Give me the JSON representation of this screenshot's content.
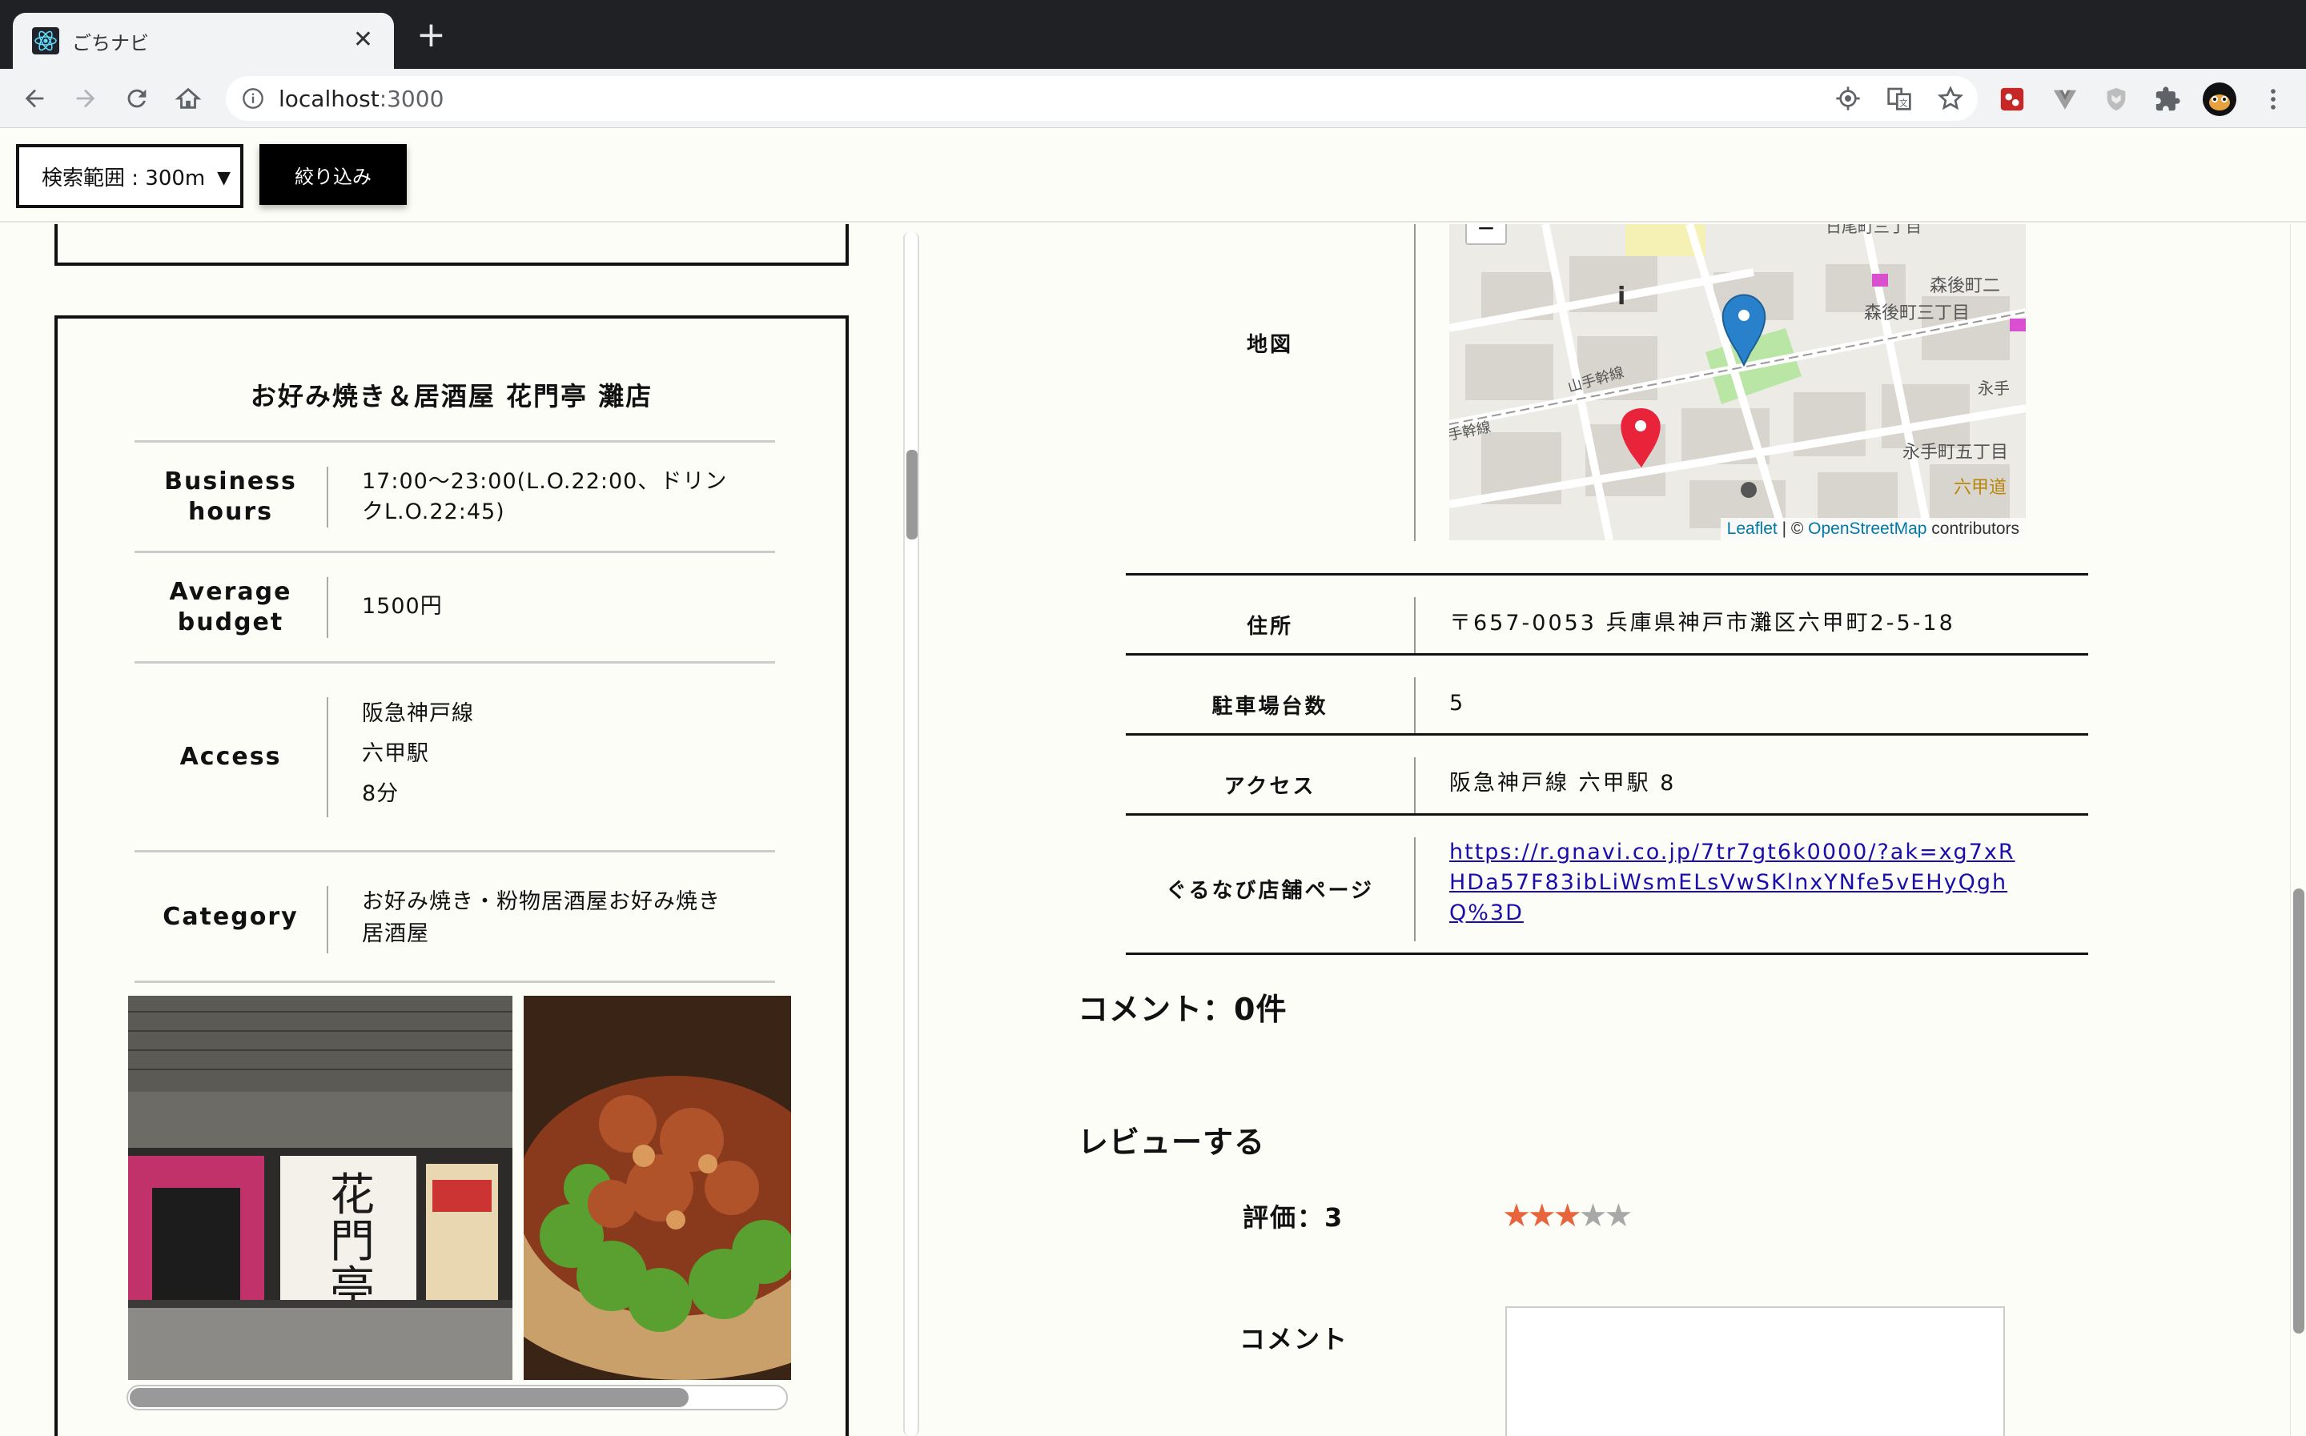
{
  "browser": {
    "tab_title": "ごちナビ",
    "url_host": "localhost",
    "url_port": ":3000",
    "new_tab": "+",
    "close_tab": "✕"
  },
  "filter": {
    "range_label": "検索範囲 : 300m",
    "submit_label": "絞り込み"
  },
  "shop_card": {
    "name": "お好み焼き＆居酒屋 花門亭 灘店",
    "rows": [
      {
        "label": "Business hours",
        "value": "17:00～23:00(L.O.22:00、ドリンクL.O.22:45)"
      },
      {
        "label": "Average budget",
        "value": "1500円"
      },
      {
        "label": "Access",
        "lines": [
          "阪急神戸線",
          "六甲駅",
          "8分"
        ]
      },
      {
        "label": "Category",
        "value": "お好み焼き・粉物居酒屋お好み焼き居酒屋"
      }
    ]
  },
  "detail": {
    "map_label": "地図",
    "map": {
      "attribution_leaflet": "Leaflet",
      "attribution_sep": " | © ",
      "attribution_osm": "OpenStreetMap",
      "attribution_contrib": " contributors",
      "zoom_out": "−",
      "place_labels": [
        "森後町三丁目",
        "森後町二",
        "永手町五丁目",
        "六甲道",
        "山手幹線",
        "手幹線",
        "日尾町三丁目",
        "永手"
      ]
    },
    "rows": [
      {
        "label": "住所",
        "value": "〒657-0053 兵庫県神戸市灘区六甲町2-5-18"
      },
      {
        "label": "駐車場台数",
        "value": "5"
      },
      {
        "label": "アクセス",
        "value": "阪急神戸線 六甲駅 8"
      },
      {
        "label": "ぐるなび店舗ページ",
        "value": "https://r.gnavi.co.jp/7tr7gt6k0000/?ak=xg7xRHDa57F83ibLiWsmELsVwSKlnxYNfe5vEHyQghQ%3D"
      }
    ],
    "comments_heading": "コメント：0件",
    "review_heading": "レビューする",
    "rating_label": "評価：3",
    "rating": 3,
    "rating_max": 5,
    "comment_label": "コメント"
  },
  "colors": {
    "star_on": "#e8643c",
    "star_off": "#a8a8a8",
    "link": "#1a0dab"
  }
}
